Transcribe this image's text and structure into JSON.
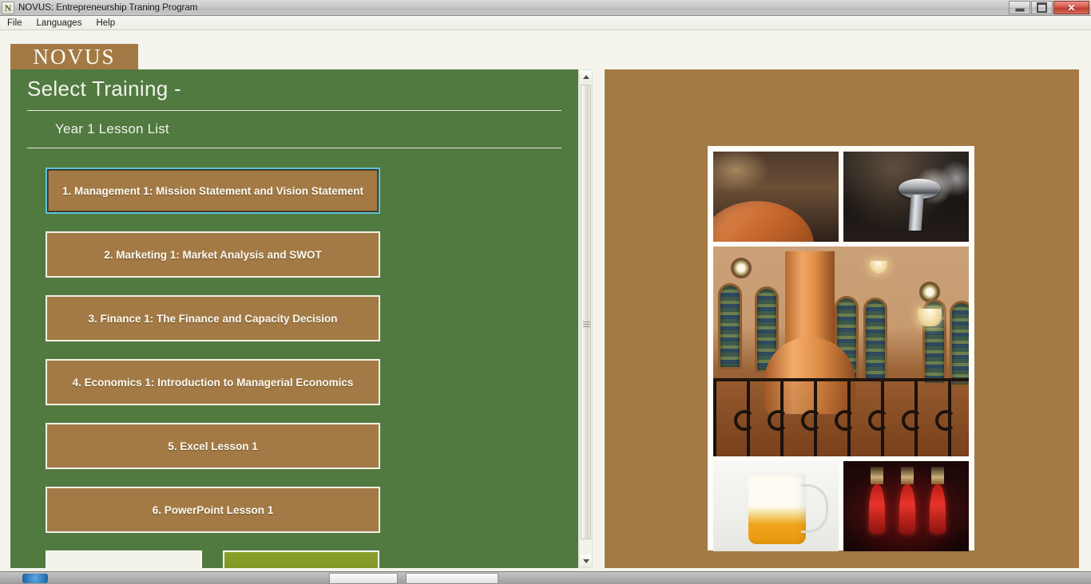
{
  "window": {
    "title": "NOVUS: Entrepreneurship Traning Program",
    "icon": "N",
    "controls": {
      "minimize": "minimize-icon",
      "maximize": "restore-icon",
      "close": "✕"
    }
  },
  "menubar": {
    "items": [
      {
        "label": "File"
      },
      {
        "label": "Languages"
      },
      {
        "label": "Help"
      }
    ]
  },
  "branding": {
    "logo_text": "NOVUS",
    "logo_bg": "#a37a45"
  },
  "panel": {
    "title": "Select Training -",
    "subtitle": "Year 1 Lesson List",
    "bg_color": "#517a40",
    "button_color": "#a37a45"
  },
  "lessons": [
    {
      "label": "1. Management 1: Mission Statement and Vision Statement",
      "focused": true
    },
    {
      "label": "2. Marketing 1: Market Analysis and SWOT",
      "focused": false
    },
    {
      "label": "3. Finance 1: The Finance and Capacity Decision",
      "focused": false
    },
    {
      "label": "4. Economics 1: Introduction to Managerial Economics",
      "focused": false
    },
    {
      "label": "5. Excel Lesson 1",
      "focused": false
    },
    {
      "label": "6. PowerPoint Lesson 1",
      "focused": false
    }
  ],
  "bottom_actions": [
    {
      "label": "",
      "style": "light"
    },
    {
      "label": "",
      "style": "olive",
      "color": "#7d9424"
    }
  ],
  "scrollbar": {
    "up_arrow": "scroll-up-icon",
    "down_arrow": "scroll-down-icon"
  },
  "gallery": {
    "frame_color": "#fdfcf7",
    "background": "#a37a45",
    "photos": [
      {
        "caption": "brewery-hall-copper-tank"
      },
      {
        "caption": "chrome-beer-taps"
      },
      {
        "caption": "brewery-interior-copper-kettle-arched-windows"
      },
      {
        "caption": "beer-glass-with-foam"
      },
      {
        "caption": "inverted-red-bottles"
      }
    ]
  }
}
